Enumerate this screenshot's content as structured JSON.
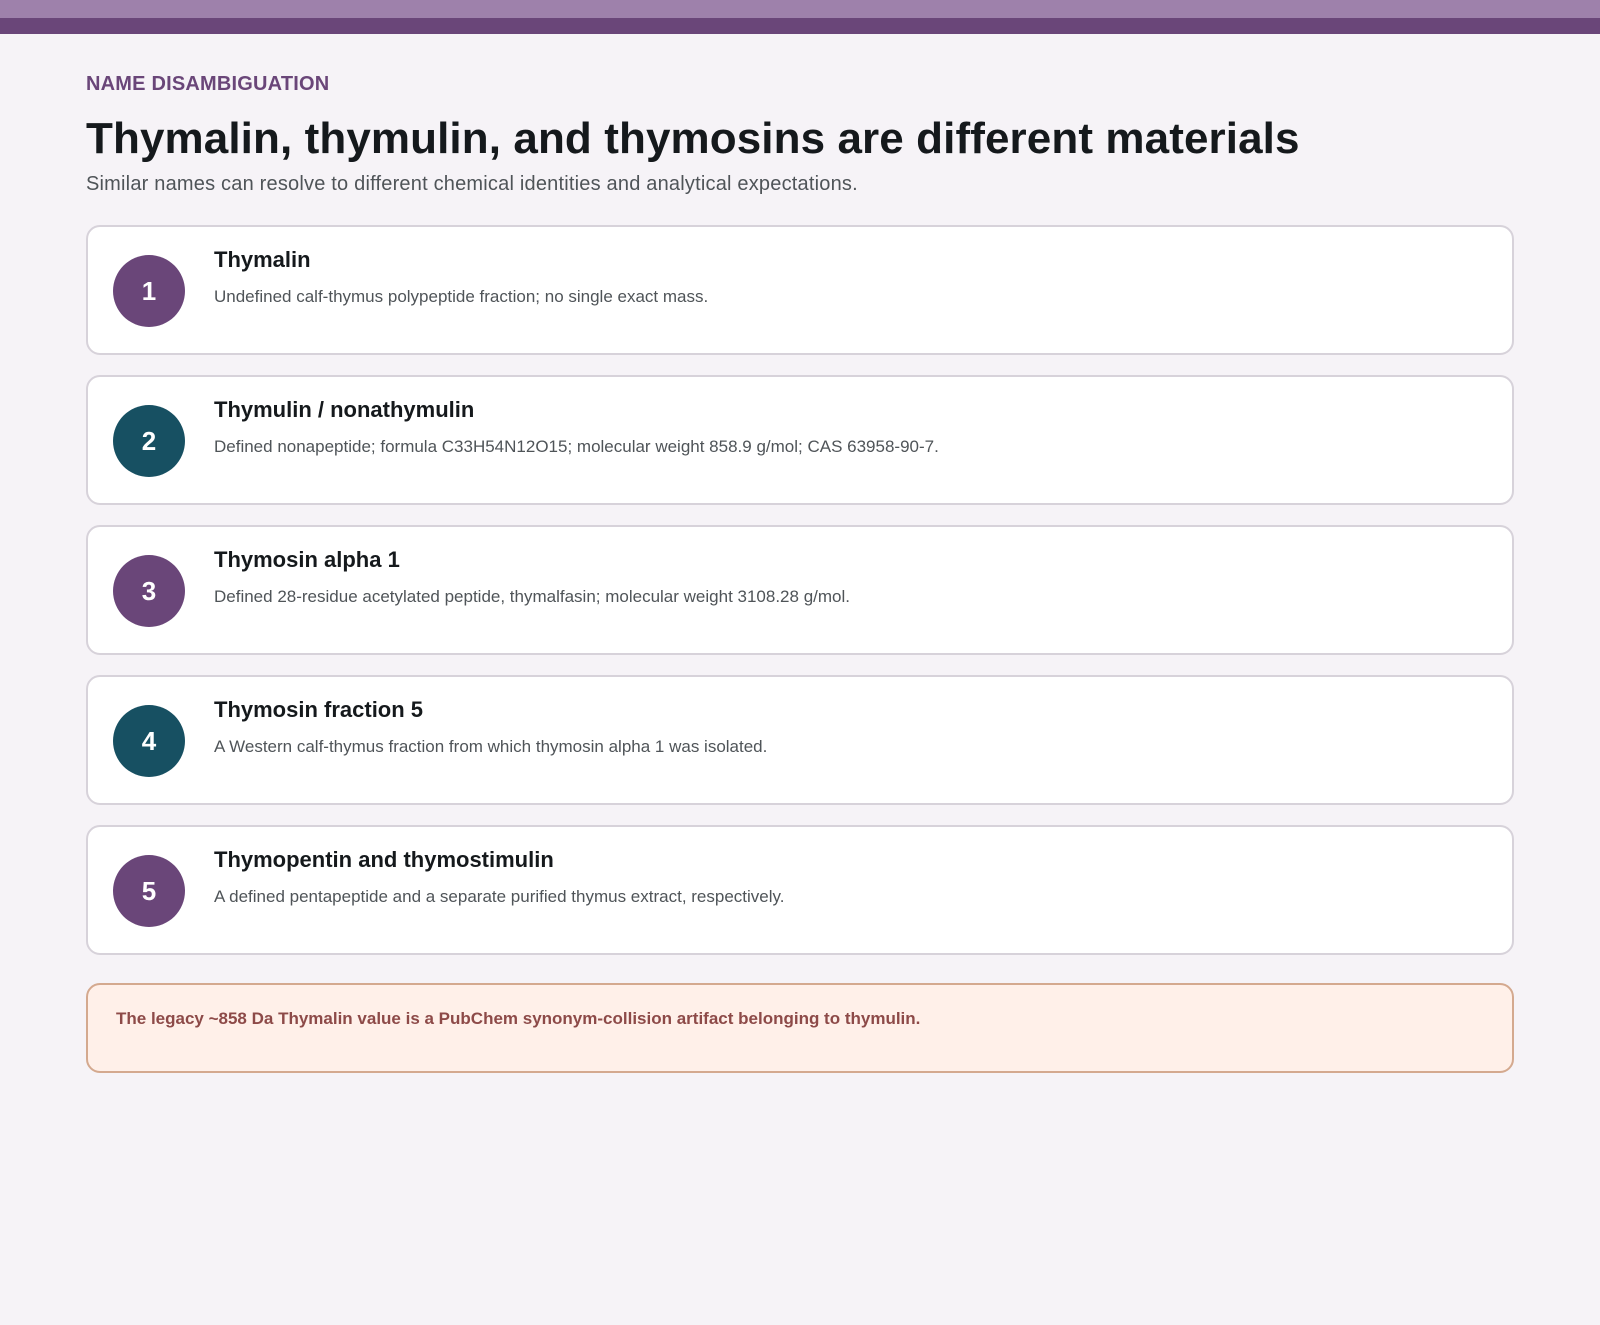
{
  "header": {
    "eyebrow": "NAME DISAMBIGUATION",
    "title": "Thymalin, thymulin, and thymosins are different materials",
    "subtitle": "Similar names can resolve to different chemical identities and analytical expectations."
  },
  "items": [
    {
      "number": "1",
      "title": "Thymalin",
      "description": "Undefined calf-thymus polypeptide fraction; no single exact mass.",
      "badge_color": "#6a4679"
    },
    {
      "number": "2",
      "title": "Thymulin / nonathymulin",
      "description": "Defined nonapeptide; formula C33H54N12O15; molecular weight 858.9 g/mol; CAS 63958-90-7.",
      "badge_color": "#175062"
    },
    {
      "number": "3",
      "title": "Thymosin alpha 1",
      "description": "Defined 28-residue acetylated peptide, thymalfasin; molecular weight 3108.28 g/mol.",
      "badge_color": "#6a4679"
    },
    {
      "number": "4",
      "title": "Thymosin fraction 5",
      "description": "A Western calf-thymus fraction from which thymosin alpha 1 was isolated.",
      "badge_color": "#175062"
    },
    {
      "number": "5",
      "title": "Thymopentin and thymostimulin",
      "description": "A defined pentapeptide and a separate purified thymus extract, respectively.",
      "badge_color": "#6a4679"
    }
  ],
  "note": {
    "text": "The legacy ~858 Da Thymalin value is a PubChem synonym-collision artifact belonging to thymulin."
  },
  "colors": {
    "accent_purple": "#6a4679",
    "accent_teal": "#175062",
    "note_text": "#8d4a48",
    "note_background": "#fff0e9"
  }
}
